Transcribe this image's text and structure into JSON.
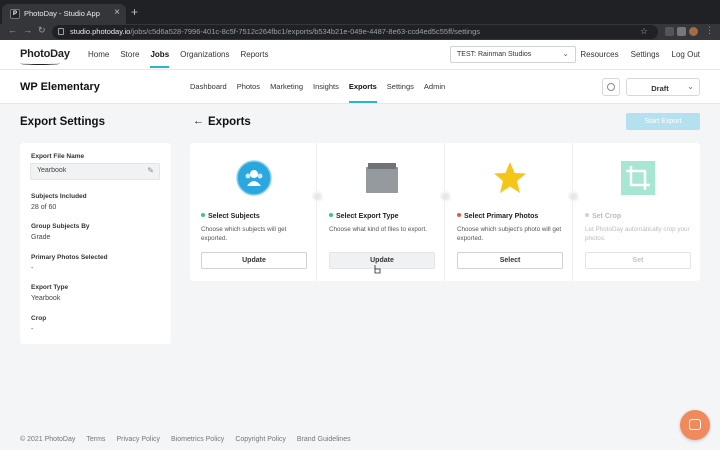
{
  "browser": {
    "tab_title": "PhotoDay - Studio App",
    "url_host": "studio.photoday.io",
    "url_path": "/jobs/c5d6a528-7996-401c-8c5f-7512c264fbc1/exports/b534b21e-049e-4487-8e63-ccd4ed5c55ff/settings"
  },
  "header": {
    "logo": "PhotoDay",
    "nav": [
      "Home",
      "Store",
      "Jobs",
      "Organizations",
      "Reports"
    ],
    "active_nav": "Jobs",
    "studio_select": "TEST: Rainman Studios",
    "right_nav": [
      "Resources",
      "Settings",
      "Log Out"
    ]
  },
  "subheader": {
    "job_title": "WP Elementary",
    "tabs": [
      "Dashboard",
      "Photos",
      "Marketing",
      "Insights",
      "Exports",
      "Settings",
      "Admin"
    ],
    "active_tab": "Exports",
    "status": "Draft"
  },
  "settings": {
    "title": "Export Settings",
    "file_name_label": "Export File Name",
    "file_name_value": "Yearbook",
    "subjects_included_label": "Subjects Included",
    "subjects_included_value": "28 of 60",
    "group_by_label": "Group Subjects By",
    "group_by_value": "Grade",
    "primary_photos_label": "Primary Photos Selected",
    "primary_photos_value": "-",
    "export_type_label": "Export Type",
    "export_type_value": "Yearbook",
    "crop_label": "Crop",
    "crop_value": "-"
  },
  "exports": {
    "heading": "Exports",
    "start_button": "Start Export",
    "steps": [
      {
        "title": "Select Subjects",
        "desc": "Choose which subjects will get exported.",
        "button": "Update",
        "bullet": "#3cc48b",
        "icon": "subjects-icon"
      },
      {
        "title": "Select Export Type",
        "desc": "Choose what kind of files to export.",
        "button": "Update",
        "bullet": "#3cc48b",
        "icon": "folder-icon"
      },
      {
        "title": "Select Primary Photos",
        "desc": "Choose which subject's photo will get exported.",
        "button": "Select",
        "bullet": "#e05a4f",
        "icon": "star-icon"
      },
      {
        "title": "Set Crop",
        "desc": "Let PhotoDay automatically crop your photos.",
        "button": "Set",
        "bullet": "#cfd3d6",
        "icon": "crop-icon"
      }
    ]
  },
  "footer": [
    "© 2021 PhotoDay",
    "Terms",
    "Privacy Policy",
    "Biometrics Policy",
    "Copyright Policy",
    "Brand Guidelines"
  ],
  "colors": {
    "accent": "#2bb3d4",
    "start_export_disabled": "#b4e0ef",
    "chat": "#f08a5d"
  }
}
